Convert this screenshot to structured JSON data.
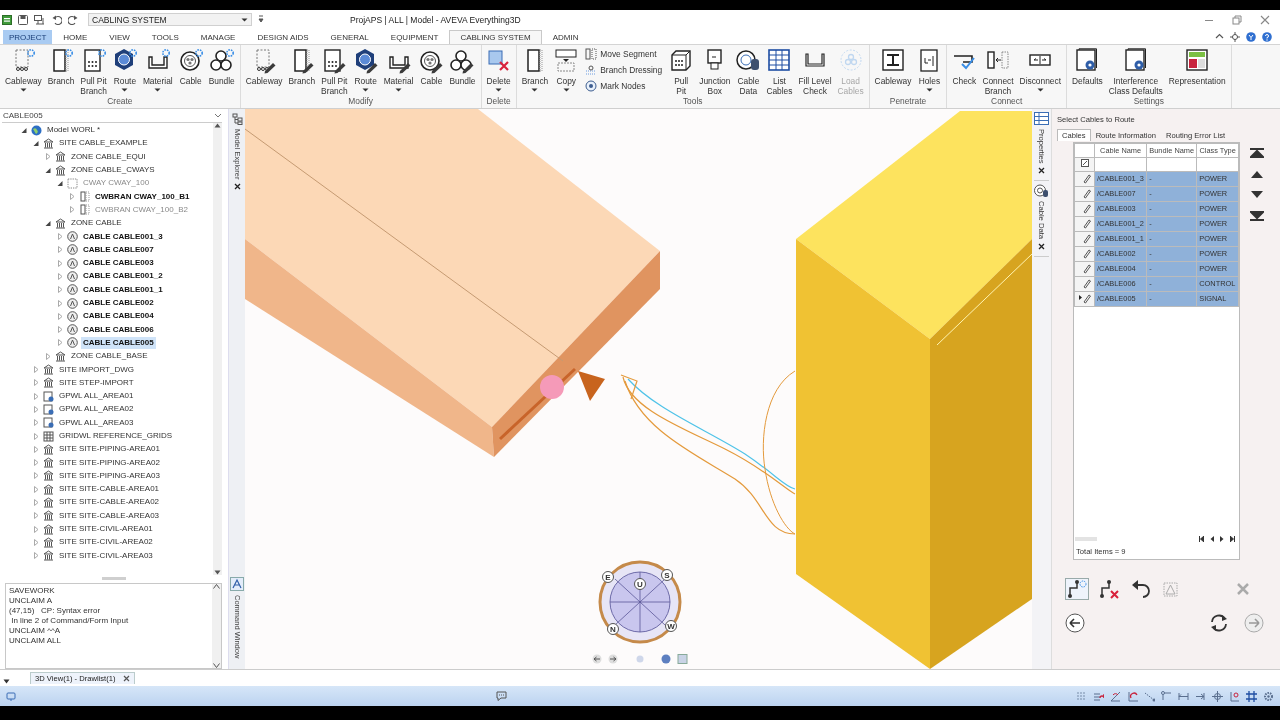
{
  "window": {
    "title": "ProjAPS | ALL | Model - AVEVA Everything3D"
  },
  "quick_access": {
    "module": "CABLING SYSTEM"
  },
  "ribbon_tabs": [
    {
      "label": "PROJECT",
      "kind": "menu",
      "selected": false
    },
    {
      "label": "HOME",
      "kind": "tab",
      "selected": false
    },
    {
      "label": "VIEW",
      "kind": "tab",
      "selected": false
    },
    {
      "label": "TOOLS",
      "kind": "tab",
      "selected": false
    },
    {
      "label": "MANAGE",
      "kind": "tab",
      "selected": false
    },
    {
      "label": "DESIGN AIDS",
      "kind": "tab",
      "selected": false
    },
    {
      "label": "GENERAL",
      "kind": "tab",
      "selected": false
    },
    {
      "label": "EQUIPMENT",
      "kind": "tab",
      "selected": false
    },
    {
      "label": "CABLING SYSTEM",
      "kind": "tab",
      "selected": true
    },
    {
      "label": "ADMIN",
      "kind": "tab",
      "selected": false
    }
  ],
  "ribbon_groups": [
    {
      "title": "Create",
      "buttons": [
        {
          "kind": "large",
          "label": "Cableway",
          "dropdown": true,
          "disabled": false
        },
        {
          "kind": "large",
          "label": "Branch",
          "dropdown": false,
          "disabled": false
        },
        {
          "kind": "large",
          "label": "Pull Pit\nBranch",
          "dropdown": false,
          "disabled": false
        },
        {
          "kind": "large",
          "label": "Route",
          "dropdown": true,
          "disabled": false
        },
        {
          "kind": "large",
          "label": "Material",
          "dropdown": true,
          "disabled": false
        },
        {
          "kind": "large",
          "label": "Cable",
          "dropdown": false,
          "disabled": false
        },
        {
          "kind": "large",
          "label": "Bundle",
          "dropdown": false,
          "disabled": false
        }
      ]
    },
    {
      "title": "Modify",
      "buttons": [
        {
          "kind": "large",
          "label": "Cableway",
          "dropdown": false,
          "disabled": false
        },
        {
          "kind": "large",
          "label": "Branch",
          "dropdown": false,
          "disabled": false
        },
        {
          "kind": "large",
          "label": "Pull Pit\nBranch",
          "dropdown": false,
          "disabled": false
        },
        {
          "kind": "large",
          "label": "Route",
          "dropdown": true,
          "disabled": false
        },
        {
          "kind": "large",
          "label": "Material",
          "dropdown": true,
          "disabled": false
        },
        {
          "kind": "large",
          "label": "Cable",
          "dropdown": false,
          "disabled": false
        },
        {
          "kind": "large",
          "label": "Bundle",
          "dropdown": false,
          "disabled": false
        }
      ]
    },
    {
      "title": "Delete",
      "buttons": [
        {
          "kind": "large",
          "label": "Delete",
          "dropdown": true,
          "disabled": false
        }
      ]
    },
    {
      "title": "Tools",
      "buttons": [
        {
          "kind": "large",
          "label": "Branch",
          "dropdown": true,
          "disabled": false
        },
        {
          "kind": "large",
          "label": "Copy",
          "dropdown": true,
          "disabled": false
        },
        {
          "kind": "small",
          "label": "Move Segment",
          "dropdown": false,
          "disabled": false
        },
        {
          "kind": "small",
          "label": "Branch Dressing",
          "dropdown": false,
          "disabled": false
        },
        {
          "kind": "small",
          "label": "Mark Nodes",
          "dropdown": false,
          "disabled": false
        },
        {
          "kind": "large",
          "label": "Pull\nPit",
          "dropdown": false,
          "disabled": false
        },
        {
          "kind": "large",
          "label": "Junction\nBox",
          "dropdown": false,
          "disabled": false
        },
        {
          "kind": "large",
          "label": "Cable\nData",
          "dropdown": false,
          "disabled": false
        },
        {
          "kind": "large",
          "label": "List\nCables",
          "dropdown": false,
          "disabled": false
        },
        {
          "kind": "large",
          "label": "Fill Level\nCheck",
          "dropdown": false,
          "disabled": false
        },
        {
          "kind": "large",
          "label": "Load\nCables",
          "dropdown": false,
          "disabled": true
        }
      ]
    },
    {
      "title": "Penetrate",
      "buttons": [
        {
          "kind": "large",
          "label": "Cableway",
          "dropdown": false,
          "disabled": false
        },
        {
          "kind": "large",
          "label": "Holes",
          "dropdown": true,
          "disabled": false
        }
      ]
    },
    {
      "title": "Connect",
      "buttons": [
        {
          "kind": "large",
          "label": "Check",
          "dropdown": false,
          "disabled": false
        },
        {
          "kind": "large",
          "label": "Connect\nBranch",
          "dropdown": false,
          "disabled": false
        },
        {
          "kind": "large",
          "label": "Disconnect",
          "dropdown": true,
          "disabled": false
        }
      ]
    },
    {
      "title": "Settings",
      "buttons": [
        {
          "kind": "large",
          "label": "Defaults",
          "dropdown": false,
          "disabled": false
        },
        {
          "kind": "large",
          "label": "Interference\nClass Defaults",
          "dropdown": false,
          "disabled": false
        },
        {
          "kind": "large",
          "label": "Representation",
          "dropdown": false,
          "disabled": false
        }
      ]
    }
  ],
  "explorer": {
    "title": "Model Explorer",
    "search": "CABLE005",
    "tree": [
      {
        "label": "Model WORL *",
        "kind": "world",
        "expanded": true,
        "bold": false,
        "dimmed": false,
        "selected": false,
        "children": [
          {
            "label": "SITE CABLE_EXAMPLE",
            "kind": "site",
            "expanded": true,
            "bold": false,
            "dimmed": false,
            "selected": false,
            "children": [
              {
                "label": "ZONE CABLE_EQUI",
                "kind": "site",
                "expanded": false,
                "bold": false,
                "dimmed": false,
                "selected": false
              },
              {
                "label": "ZONE CABLE_CWAYS",
                "kind": "site",
                "expanded": true,
                "bold": false,
                "dimmed": false,
                "selected": false,
                "children": [
                  {
                    "label": "CWAY CWAY_100",
                    "kind": "cway",
                    "expanded": true,
                    "bold": false,
                    "dimmed": true,
                    "selected": false,
                    "children": [
                      {
                        "label": "CWBRAN CWAY_100_B1",
                        "kind": "cwbran",
                        "expanded": false,
                        "bold": true,
                        "dimmed": false,
                        "selected": false
                      },
                      {
                        "label": "CWBRAN CWAY_100_B2",
                        "kind": "cwbran",
                        "expanded": false,
                        "bold": false,
                        "dimmed": true,
                        "selected": false
                      }
                    ]
                  }
                ]
              },
              {
                "label": "ZONE CABLE",
                "kind": "site",
                "expanded": true,
                "bold": false,
                "dimmed": false,
                "selected": false,
                "children": [
                  {
                    "label": "CABLE CABLE001_3",
                    "kind": "cable",
                    "expanded": false,
                    "bold": true,
                    "dimmed": false,
                    "selected": false
                  },
                  {
                    "label": "CABLE CABLE007",
                    "kind": "cable",
                    "expanded": false,
                    "bold": true,
                    "dimmed": false,
                    "selected": false
                  },
                  {
                    "label": "CABLE CABLE003",
                    "kind": "cable",
                    "expanded": false,
                    "bold": true,
                    "dimmed": false,
                    "selected": false
                  },
                  {
                    "label": "CABLE CABLE001_2",
                    "kind": "cable",
                    "expanded": false,
                    "bold": true,
                    "dimmed": false,
                    "selected": false
                  },
                  {
                    "label": "CABLE CABLE001_1",
                    "kind": "cable",
                    "expanded": false,
                    "bold": true,
                    "dimmed": false,
                    "selected": false
                  },
                  {
                    "label": "CABLE CABLE002",
                    "kind": "cable",
                    "expanded": false,
                    "bold": true,
                    "dimmed": false,
                    "selected": false
                  },
                  {
                    "label": "CABLE CABLE004",
                    "kind": "cable",
                    "expanded": false,
                    "bold": true,
                    "dimmed": false,
                    "selected": false
                  },
                  {
                    "label": "CABLE CABLE006",
                    "kind": "cable",
                    "expanded": false,
                    "bold": true,
                    "dimmed": false,
                    "selected": false
                  },
                  {
                    "label": "CABLE CABLE005",
                    "kind": "cable",
                    "expanded": false,
                    "bold": true,
                    "dimmed": false,
                    "selected": true
                  }
                ]
              },
              {
                "label": "ZONE CABLE_BASE",
                "kind": "site",
                "expanded": false,
                "bold": false,
                "dimmed": false,
                "selected": false
              }
            ]
          },
          {
            "label": "SITE IMPORT_DWG",
            "kind": "site",
            "expanded": false,
            "bold": false,
            "dimmed": false,
            "selected": false
          },
          {
            "label": "SITE STEP-IMPORT",
            "kind": "site",
            "expanded": false,
            "bold": false,
            "dimmed": false,
            "selected": false
          },
          {
            "label": "GPWL ALL_AREA01",
            "kind": "gpwl",
            "expanded": false,
            "bold": false,
            "dimmed": false,
            "selected": false
          },
          {
            "label": "GPWL ALL_AREA02",
            "kind": "gpwl",
            "expanded": false,
            "bold": false,
            "dimmed": false,
            "selected": false
          },
          {
            "label": "GPWL ALL_AREA03",
            "kind": "gpwl",
            "expanded": false,
            "bold": false,
            "dimmed": false,
            "selected": false
          },
          {
            "label": "GRIDWL REFERENCE_GRIDS",
            "kind": "gridwl",
            "expanded": false,
            "bold": false,
            "dimmed": false,
            "selected": false
          },
          {
            "label": "SITE SITE-PIPING-AREA01",
            "kind": "site",
            "expanded": false,
            "bold": false,
            "dimmed": false,
            "selected": false
          },
          {
            "label": "SITE SITE-PIPING-AREA02",
            "kind": "site",
            "expanded": false,
            "bold": false,
            "dimmed": false,
            "selected": false
          },
          {
            "label": "SITE SITE-PIPING-AREA03",
            "kind": "site",
            "expanded": false,
            "bold": false,
            "dimmed": false,
            "selected": false
          },
          {
            "label": "SITE SITE-CABLE-AREA01",
            "kind": "site",
            "expanded": false,
            "bold": false,
            "dimmed": false,
            "selected": false
          },
          {
            "label": "SITE SITE-CABLE-AREA02",
            "kind": "site",
            "expanded": false,
            "bold": false,
            "dimmed": false,
            "selected": false
          },
          {
            "label": "SITE SITE-CABLE-AREA03",
            "kind": "site",
            "expanded": false,
            "bold": false,
            "dimmed": false,
            "selected": false
          },
          {
            "label": "SITE SITE-CIVIL-AREA01",
            "kind": "site",
            "expanded": false,
            "bold": false,
            "dimmed": false,
            "selected": false
          },
          {
            "label": "SITE SITE-CIVIL-AREA02",
            "kind": "site",
            "expanded": false,
            "bold": false,
            "dimmed": false,
            "selected": false
          },
          {
            "label": "SITE SITE-CIVIL-AREA03",
            "kind": "site",
            "expanded": false,
            "bold": false,
            "dimmed": false,
            "selected": false
          }
        ]
      }
    ]
  },
  "command_window": {
    "title": "Command Window",
    "lines": [
      "SAVEWORK",
      "UNCLAIM A",
      "(47,15)   CP: Syntax error",
      " In line 2 of Command/Form Input",
      "UNCLAIM ^^A",
      "UNCLAIM ALL"
    ]
  },
  "viewport": {
    "compass_labels": [
      "E",
      "U",
      "S",
      "N",
      "W"
    ]
  },
  "document_tabs": [
    {
      "label": "3D View(1) - Drawlist(1)",
      "selected": true
    }
  ],
  "side_tabs": [
    {
      "label": "Properties"
    },
    {
      "label": "Cable Data"
    }
  ],
  "route_panel": {
    "title": "Select Cables to Route",
    "tabs": [
      {
        "label": "Cables",
        "selected": true
      },
      {
        "label": "Route Information",
        "selected": false
      },
      {
        "label": "Routing Error List",
        "selected": false
      }
    ],
    "columns": [
      "Cable Name",
      "Bundle Name",
      "Class Type"
    ],
    "rows": [
      {
        "cable": "/CABLE001_3",
        "bundle": "-",
        "class": "POWER",
        "selected": true,
        "current": false
      },
      {
        "cable": "/CABLE007",
        "bundle": "-",
        "class": "POWER",
        "selected": true,
        "current": false
      },
      {
        "cable": "/CABLE003",
        "bundle": "-",
        "class": "POWER",
        "selected": true,
        "current": false
      },
      {
        "cable": "/CABLE001_2",
        "bundle": "-",
        "class": "POWER",
        "selected": true,
        "current": false
      },
      {
        "cable": "/CABLE001_1",
        "bundle": "-",
        "class": "POWER",
        "selected": true,
        "current": false
      },
      {
        "cable": "/CABLE002",
        "bundle": "-",
        "class": "POWER",
        "selected": true,
        "current": false
      },
      {
        "cable": "/CABLE004",
        "bundle": "-",
        "class": "POWER",
        "selected": true,
        "current": false
      },
      {
        "cable": "/CABLE006",
        "bundle": "-",
        "class": "CONTROL",
        "selected": true,
        "current": false
      },
      {
        "cable": "/CABLE005",
        "bundle": "-",
        "class": "SIGNAL",
        "selected": true,
        "current": true
      }
    ],
    "total": "Total Items = 9"
  }
}
